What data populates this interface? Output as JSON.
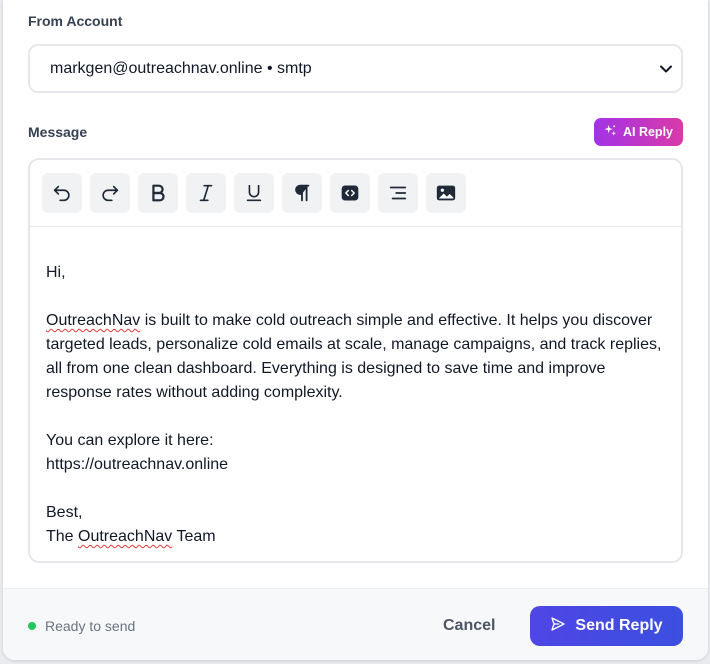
{
  "from_account": {
    "label": "From Account",
    "selected_value": "markgen@outreachnav.online • smtp"
  },
  "message": {
    "label": "Message",
    "ai_reply_label": "AI Reply",
    "toolbar": [
      {
        "name": "undo-icon"
      },
      {
        "name": "redo-icon"
      },
      {
        "name": "bold-icon"
      },
      {
        "name": "italic-icon"
      },
      {
        "name": "underline-icon"
      },
      {
        "name": "paragraph-icon"
      },
      {
        "name": "code-icon"
      },
      {
        "name": "align-right-icon"
      },
      {
        "name": "image-icon"
      }
    ],
    "body": {
      "greeting": "Hi,",
      "para_word_1": "OutreachNav",
      "para_rest_1": " is built to make cold outreach simple and effective. It helps you discover targeted leads, personalize cold emails at scale, manage campaigns, and track replies, all from one clean dashboard. Everything is designed to save time and improve response rates without adding complexity.",
      "explore_line": "You can explore it here:",
      "link": "https://outreachnav.online",
      "signoff": "Best,",
      "sign_prefix": "The ",
      "sign_word": "OutreachNav",
      "sign_suffix": " Team"
    }
  },
  "footer": {
    "status_text": "Ready to send",
    "cancel_label": "Cancel",
    "send_label": "Send Reply"
  },
  "colors": {
    "status_green": "#22c55e",
    "send_button": "#4f46e5",
    "ai_gradient_start": "#a333e6",
    "ai_gradient_end": "#d93aa8",
    "spellcheck": "#e23b3b"
  }
}
